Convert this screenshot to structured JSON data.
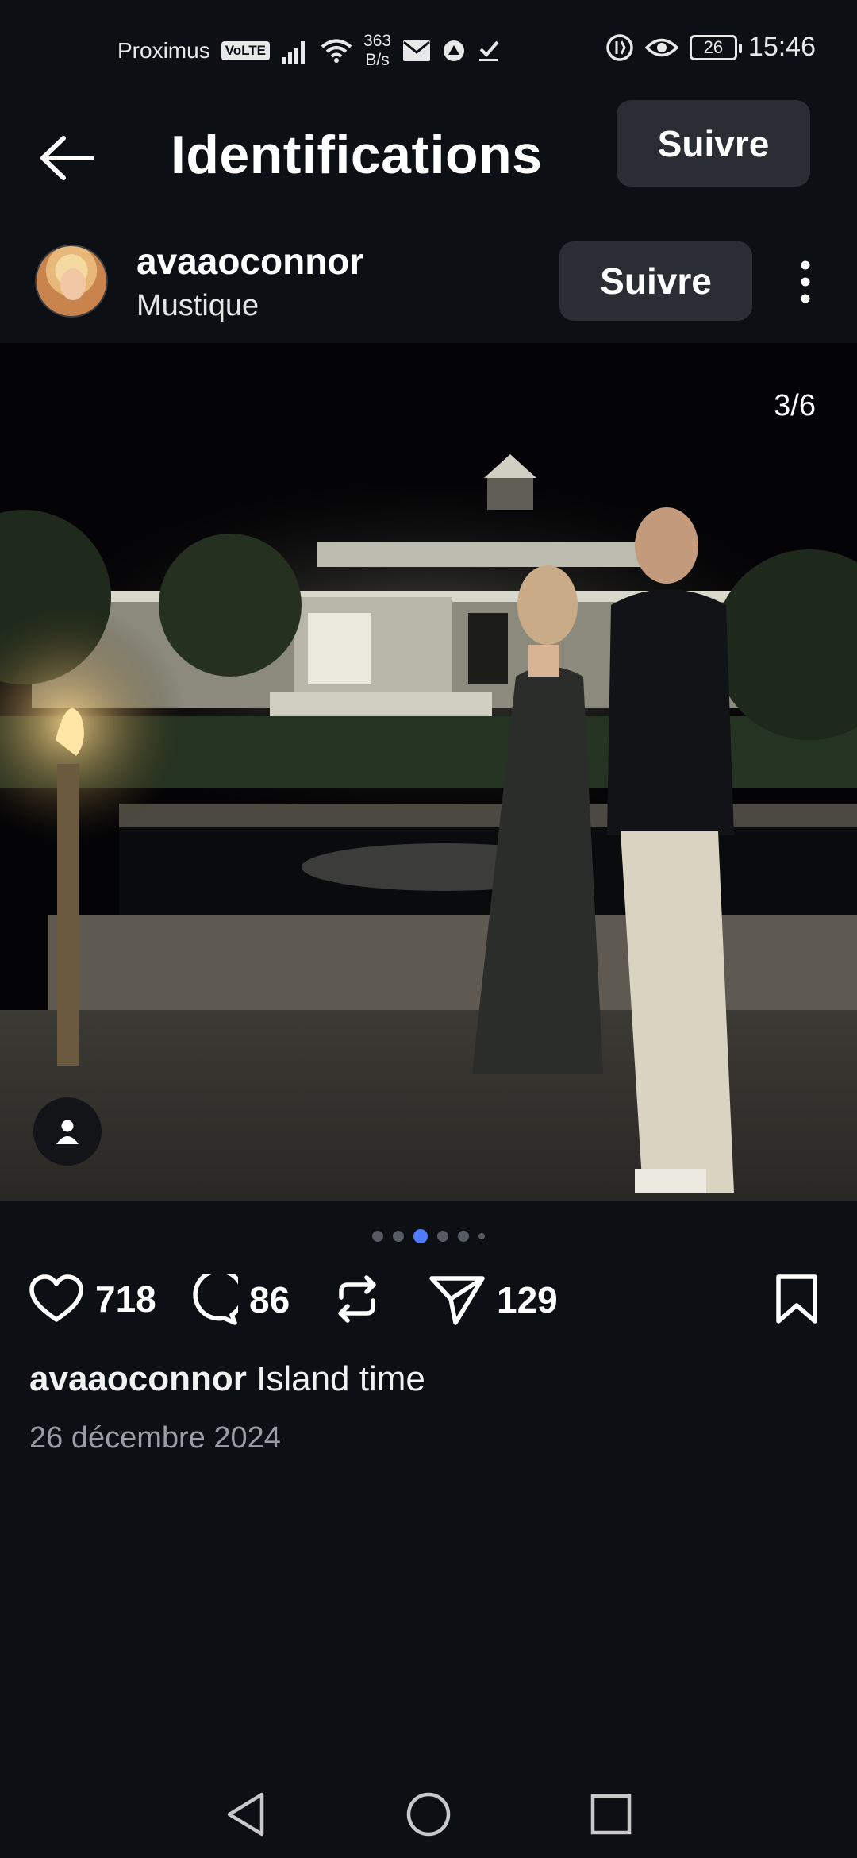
{
  "status_bar": {
    "carrier": "Proximus",
    "volte": "VoLTE",
    "speed_value": "363",
    "speed_unit": "B/s",
    "battery": "26",
    "time": "15:46"
  },
  "header": {
    "title": "Identifications",
    "follow_label": "Suivre"
  },
  "post": {
    "username": "avaaoconnor",
    "location": "Mustique",
    "follow_label": "Suivre",
    "page_counter": "3/6",
    "carousel": {
      "total": 6,
      "active_index": 2
    },
    "likes": "718",
    "comments": "86",
    "shares": "129",
    "caption_user": "avaaoconnor",
    "caption_text": "Island time",
    "date": "26 décembre 2024"
  },
  "icons": {
    "back": "arrow-left-icon",
    "more": "more-vertical-icon",
    "tag": "person-tag-icon",
    "like": "heart-icon",
    "comment": "comment-icon",
    "repost": "repost-icon",
    "share": "send-icon",
    "save": "bookmark-icon",
    "nav_back": "triangle-back-icon",
    "nav_home": "circle-home-icon",
    "nav_recents": "square-recents-icon"
  },
  "colors": {
    "background": "#0c0f14",
    "button": "#2a2d33",
    "active_dot": "#4f7cff",
    "muted_text": "#9a9ea6"
  }
}
